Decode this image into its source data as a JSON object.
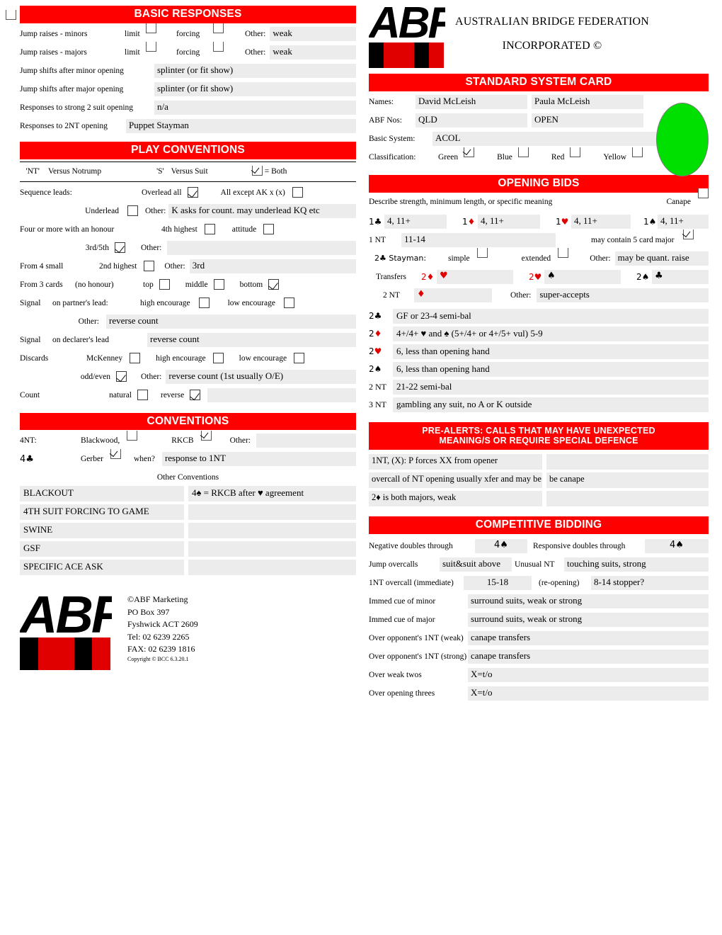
{
  "header": {
    "logo_word": "ABF",
    "federation_line1": "AUSTRALIAN BRIDGE FEDERATION",
    "federation_line2": "INCORPORATED ©",
    "card_title": "STANDARD SYSTEM CARD",
    "names_label": "Names:",
    "name1": "David McLeish",
    "name2": "Paula McLeish",
    "abf_nos_label": "ABF Nos:",
    "abf_no1": "QLD",
    "abf_no2": "OPEN",
    "basic_system_label": "Basic System:",
    "basic_system": "ACOL",
    "classification_label": "Classification:",
    "classifications": [
      {
        "label": "Green",
        "checked": true
      },
      {
        "label": "Blue",
        "checked": false
      },
      {
        "label": "Red",
        "checked": false
      },
      {
        "label": "Yellow",
        "checked": false
      }
    ],
    "classification_color": "#00e000"
  },
  "basic_responses": {
    "title": "BASIC RESPONSES",
    "rows": [
      {
        "label": "Jump raises - minors",
        "cb1": "limit",
        "cb1_checked": false,
        "cb2": "forcing",
        "cb2_checked": false,
        "other_label": "Other:",
        "other": "weak"
      },
      {
        "label": "Jump raises - majors",
        "cb1": "limit",
        "cb1_checked": false,
        "cb2": "forcing",
        "cb2_checked": false,
        "other_label": "Other:",
        "other": "weak"
      }
    ],
    "text_rows": [
      {
        "label": "Jump shifts after minor opening",
        "value": "splinter (or fit show)"
      },
      {
        "label": "Jump shifts after major opening",
        "value": "splinter (or fit show)"
      },
      {
        "label": "Responses to strong 2 suit opening",
        "value": "n/a"
      },
      {
        "label": "Responses to 2NT opening",
        "value": "Puppet Stayman"
      }
    ]
  },
  "play_conventions": {
    "title": "PLAY CONVENTIONS",
    "key_nt": "'NT'",
    "key_nt_text": "Versus Notrump",
    "key_s": "'S'",
    "key_s_text": "Versus Suit",
    "key_both": "= Both",
    "sequence_leads_label": "Sequence leads:",
    "overlead_all_label": "Overlead all",
    "overlead_all_checked": true,
    "all_except_label": "All except AK x (x)",
    "all_except_checked": false,
    "underlead_label": "Underlead",
    "underlead_checked": false,
    "underlead_other_label": "Other:",
    "underlead_other": "K asks for count. may underlead KQ etc",
    "four_or_more_label": "Four or more with an honour",
    "fourth_highest_label": "4th highest",
    "fourth_highest_checked": false,
    "attitude_label": "attitude",
    "attitude_checked": false,
    "third_fifth_label": "3rd/5th",
    "third_fifth_checked": true,
    "third_fifth_other_label": "Other:",
    "third_fifth_other": "",
    "from4_label": "From 4 small",
    "second_highest_label": "2nd highest",
    "second_highest_checked": false,
    "from4_other_label": "Other:",
    "from4_other": "3rd",
    "from3_label": "From 3 cards",
    "from3_note": "(no honour)",
    "top_label": "top",
    "top_checked": false,
    "middle_label": "middle",
    "middle_checked": false,
    "bottom_label": "bottom",
    "bottom_checked": true,
    "signal_label": "Signal",
    "partner_lead_label": "on partner's lead:",
    "high_enc_label": "high encourage",
    "high_enc_checked": false,
    "low_enc_label": "low encourage",
    "low_enc_checked": false,
    "partner_other_label": "Other:",
    "partner_other": "reverse count",
    "declarer_lead_label": "on declarer's lead",
    "declarer_value": "reverse count",
    "discards_label": "Discards",
    "mckenney_label": "McKenney",
    "mckenney_checked": false,
    "disc_high_label": "high encourage",
    "disc_high_checked": false,
    "disc_low_label": "low encourage",
    "disc_low_checked": false,
    "oddeven_label": "odd/even",
    "oddeven_checked": true,
    "disc_other_label": "Other:",
    "disc_other": "reverse count (1st usually O/E)",
    "count_label": "Count",
    "natural_label": "natural",
    "natural_checked": false,
    "reverse_label": "reverse",
    "reverse_checked": true,
    "count_other": ""
  },
  "conventions": {
    "title": "CONVENTIONS",
    "fournt_label": "4NT:",
    "blackwood_label": "Blackwood,",
    "blackwood_checked": false,
    "rkcb_label": "RKCB",
    "rkcb_checked": true,
    "fournt_other_label": "Other:",
    "fournt_other": "",
    "fourc_label": "4♣",
    "gerber_label": "Gerber",
    "gerber_checked": true,
    "when_label": "when?",
    "when_value": "response to 1NT",
    "other_conventions_label": "Other Conventions",
    "list": [
      {
        "name": "BLACKOUT",
        "meaning": "4♠ = RKCB after ♥ agreement"
      },
      {
        "name": "4TH SUIT FORCING TO GAME",
        "meaning": ""
      },
      {
        "name": "SWINE",
        "meaning": ""
      },
      {
        "name": "GSF",
        "meaning": ""
      },
      {
        "name": "SPECIFIC ACE ASK",
        "meaning": ""
      }
    ]
  },
  "footer": {
    "marketing": "©ABF Marketing",
    "po_box": "PO Box 397",
    "suburb": "Fyshwick ACT 2609",
    "tel": "Tel: 02 6239 2265",
    "fax": "FAX: 02 6239 1816",
    "copyright": "Copyright © BCC 6.3.20.1"
  },
  "opening_bids": {
    "title": "OPENING BIDS",
    "describe": "Describe strength, minimum length, or specific meaning",
    "canape_label": "Canape",
    "canape_checked": false,
    "one_level": [
      {
        "bid": "1",
        "suit": "♣",
        "suit_color": "black",
        "value": "4, 11+"
      },
      {
        "bid": "1",
        "suit": "♦",
        "suit_color": "red",
        "value": "4, 11+"
      },
      {
        "bid": "1",
        "suit": "♥",
        "suit_color": "red",
        "value": "4, 11+"
      },
      {
        "bid": "1",
        "suit": "♠",
        "suit_color": "black",
        "value": "4, 11+"
      }
    ],
    "nt1_label": "1 NT",
    "nt1_value": "11-14",
    "five_card_major_label": "may contain 5 card major",
    "five_card_major_checked": true,
    "stayman_label": "2♣ Stayman:",
    "simple_label": "simple",
    "simple_checked": false,
    "extended_label": "extended",
    "extended_checked": false,
    "stayman_other_label": "Other:",
    "stayman_other": "may be quant. raise",
    "transfers_label": "Transfers",
    "transfers": [
      {
        "bid": "2♦",
        "bid_color": "red",
        "shows": "♥",
        "shows_color": "red",
        "note": ""
      },
      {
        "bid": "2♥",
        "bid_color": "red",
        "shows": "♠",
        "shows_color": "black",
        "note": ""
      },
      {
        "bid": "2♠",
        "bid_color": "black",
        "shows": "♣",
        "shows_color": "black",
        "note": ""
      }
    ],
    "nt2_transfer_label": "2 NT",
    "nt2_transfer_suit": "♦",
    "nt2_transfer_other_label": "Other:",
    "nt2_transfer_other": "super-accepts",
    "higher": [
      {
        "bid": "2",
        "suit": "♣",
        "suit_color": "black",
        "value": "GF or 23-4 semi-bal"
      },
      {
        "bid": "2",
        "suit": "♦",
        "suit_color": "red",
        "value": "4+/4+ ♥ and ♠ (5+/4+ or 4+/5+ vul) 5-9"
      },
      {
        "bid": "2",
        "suit": "♥",
        "suit_color": "red",
        "value": "6, less than opening hand"
      },
      {
        "bid": "2",
        "suit": "♠",
        "suit_color": "black",
        "value": "6, less than opening hand"
      },
      {
        "bid": "2 NT",
        "suit": "",
        "suit_color": "black",
        "value": "21-22 semi-bal"
      },
      {
        "bid": "3 NT",
        "suit": "",
        "suit_color": "black",
        "value": "gambling any suit, no A or K outside"
      }
    ]
  },
  "pre_alerts": {
    "title_line1": "PRE-ALERTS: CALLS THAT MAY HAVE UNEXPECTED",
    "title_line2": "MEANING/S OR REQUIRE SPECIAL DEFENCE",
    "rows": [
      {
        "a": "1NT, (X): P forces XX from opener",
        "b": ""
      },
      {
        "a": "overcall of NT opening usually xfer and may be",
        "b": "be canape"
      },
      {
        "a": "2♦ is both majors, weak",
        "b": ""
      }
    ]
  },
  "competitive_bidding": {
    "title": "COMPETITIVE BIDDING",
    "negative_doubles_label": "Negative doubles through",
    "negative_doubles_value": "4♠",
    "responsive_doubles_label": "Responsive doubles through",
    "responsive_doubles_value": "4♠",
    "jump_overcalls_label": "Jump overcalls",
    "jump_overcalls_value": "suit&suit above",
    "unusual_nt_label": "Unusual NT",
    "unusual_nt_value": "touching suits, strong",
    "nt_overcall_label": "1NT overcall (immediate)",
    "nt_overcall_value": "15-18",
    "reopening_label": "(re-opening)",
    "reopening_value": "8-14 stopper?",
    "rows": [
      {
        "label": "Immed cue of minor",
        "value": "surround suits, weak or strong"
      },
      {
        "label": "Immed cue of major",
        "value": "surround suits, weak or strong"
      },
      {
        "label": "Over opponent's 1NT (weak)",
        "value": "canape transfers"
      },
      {
        "label": "Over opponent's 1NT (strong)",
        "value": "canape transfers"
      },
      {
        "label": "Over weak twos",
        "value": "X=t/o"
      },
      {
        "label": "Over opening threes",
        "value": "X=t/o"
      }
    ]
  }
}
